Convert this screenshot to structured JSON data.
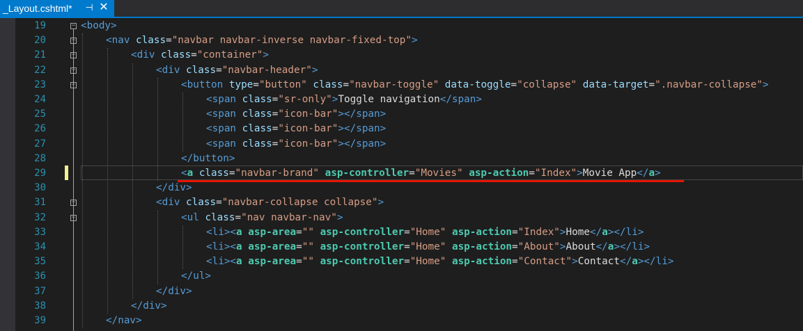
{
  "tab": {
    "title": "_Layout.cshtml*",
    "pin_glyph": "⊣",
    "close_glyph": "✕"
  },
  "colors": {
    "background": "#1e1e1e",
    "line_number": "#2b91af",
    "tag": "#569cd6",
    "attribute": "#9cdcfe",
    "string": "#d69d85",
    "tag_helper": "#4ec9b0",
    "tab_accent": "#007acc",
    "annotation": "#e51400"
  },
  "editor": {
    "lines": [
      {
        "number": "19",
        "tokens": [
          {
            "t": "tag",
            "v": "<body>"
          }
        ]
      },
      {
        "number": "20",
        "tokens": [
          {
            "t": "tag",
            "v": "<nav"
          },
          {
            "t": "txt",
            "v": " "
          },
          {
            "t": "attr",
            "v": "class"
          },
          {
            "t": "txt",
            "v": "="
          },
          {
            "t": "str",
            "v": "\"navbar navbar-inverse navbar-fixed-top\""
          },
          {
            "t": "tag",
            "v": ">"
          }
        ]
      },
      {
        "number": "21",
        "tokens": [
          {
            "t": "tag",
            "v": "<div"
          },
          {
            "t": "txt",
            "v": " "
          },
          {
            "t": "attr",
            "v": "class"
          },
          {
            "t": "txt",
            "v": "="
          },
          {
            "t": "str",
            "v": "\"container\""
          },
          {
            "t": "tag",
            "v": ">"
          }
        ]
      },
      {
        "number": "22",
        "tokens": [
          {
            "t": "tag",
            "v": "<div"
          },
          {
            "t": "txt",
            "v": " "
          },
          {
            "t": "attr",
            "v": "class"
          },
          {
            "t": "txt",
            "v": "="
          },
          {
            "t": "str",
            "v": "\"navbar-header\""
          },
          {
            "t": "tag",
            "v": ">"
          }
        ]
      },
      {
        "number": "23",
        "tokens": [
          {
            "t": "tag",
            "v": "<button"
          },
          {
            "t": "txt",
            "v": " "
          },
          {
            "t": "attr",
            "v": "type"
          },
          {
            "t": "txt",
            "v": "="
          },
          {
            "t": "str",
            "v": "\"button\""
          },
          {
            "t": "txt",
            "v": " "
          },
          {
            "t": "attr",
            "v": "class"
          },
          {
            "t": "txt",
            "v": "="
          },
          {
            "t": "str",
            "v": "\"navbar-toggle\""
          },
          {
            "t": "txt",
            "v": " "
          },
          {
            "t": "attr",
            "v": "data-toggle"
          },
          {
            "t": "txt",
            "v": "="
          },
          {
            "t": "str",
            "v": "\"collapse\""
          },
          {
            "t": "txt",
            "v": " "
          },
          {
            "t": "attr",
            "v": "data-target"
          },
          {
            "t": "txt",
            "v": "="
          },
          {
            "t": "str",
            "v": "\".navbar-collapse\""
          },
          {
            "t": "tag",
            "v": ">"
          }
        ]
      },
      {
        "number": "24",
        "tokens": [
          {
            "t": "tag",
            "v": "<span"
          },
          {
            "t": "txt",
            "v": " "
          },
          {
            "t": "attr",
            "v": "class"
          },
          {
            "t": "txt",
            "v": "="
          },
          {
            "t": "str",
            "v": "\"sr-only\""
          },
          {
            "t": "tag",
            "v": ">"
          },
          {
            "t": "txt",
            "v": "Toggle navigation"
          },
          {
            "t": "tag",
            "v": "</span>"
          }
        ]
      },
      {
        "number": "25",
        "tokens": [
          {
            "t": "tag",
            "v": "<span"
          },
          {
            "t": "txt",
            "v": " "
          },
          {
            "t": "attr",
            "v": "class"
          },
          {
            "t": "txt",
            "v": "="
          },
          {
            "t": "str",
            "v": "\"icon-bar\""
          },
          {
            "t": "tag",
            "v": "></span>"
          }
        ]
      },
      {
        "number": "26",
        "tokens": [
          {
            "t": "tag",
            "v": "<span"
          },
          {
            "t": "txt",
            "v": " "
          },
          {
            "t": "attr",
            "v": "class"
          },
          {
            "t": "txt",
            "v": "="
          },
          {
            "t": "str",
            "v": "\"icon-bar\""
          },
          {
            "t": "tag",
            "v": "></span>"
          }
        ]
      },
      {
        "number": "27",
        "tokens": [
          {
            "t": "tag",
            "v": "<span"
          },
          {
            "t": "txt",
            "v": " "
          },
          {
            "t": "attr",
            "v": "class"
          },
          {
            "t": "txt",
            "v": "="
          },
          {
            "t": "str",
            "v": "\"icon-bar\""
          },
          {
            "t": "tag",
            "v": "></span>"
          }
        ]
      },
      {
        "number": "28",
        "tokens": [
          {
            "t": "tag",
            "v": "</button>"
          }
        ]
      },
      {
        "number": "29",
        "tokens": [
          {
            "t": "tag",
            "v": "<"
          },
          {
            "t": "tagh",
            "v": "a"
          },
          {
            "t": "txt",
            "v": " "
          },
          {
            "t": "attr",
            "v": "class"
          },
          {
            "t": "txt",
            "v": "="
          },
          {
            "t": "str",
            "v": "\"navbar-brand\""
          },
          {
            "t": "txt",
            "v": " "
          },
          {
            "t": "attrh",
            "v": "asp-controller"
          },
          {
            "t": "txt",
            "v": "="
          },
          {
            "t": "str",
            "v": "\"Movies\""
          },
          {
            "t": "txt",
            "v": " "
          },
          {
            "t": "attrh",
            "v": "asp-action"
          },
          {
            "t": "txt",
            "v": "="
          },
          {
            "t": "str",
            "v": "\"Index\""
          },
          {
            "t": "tag",
            "v": ">"
          },
          {
            "t": "txt",
            "v": "Movie App"
          },
          {
            "t": "tag",
            "v": "</"
          },
          {
            "t": "tagh",
            "v": "a"
          },
          {
            "t": "tag",
            "v": ">"
          }
        ]
      },
      {
        "number": "30",
        "tokens": [
          {
            "t": "tag",
            "v": "</div>"
          }
        ]
      },
      {
        "number": "31",
        "tokens": [
          {
            "t": "tag",
            "v": "<div"
          },
          {
            "t": "txt",
            "v": " "
          },
          {
            "t": "attr",
            "v": "class"
          },
          {
            "t": "txt",
            "v": "="
          },
          {
            "t": "str",
            "v": "\"navbar-collapse collapse\""
          },
          {
            "t": "tag",
            "v": ">"
          }
        ]
      },
      {
        "number": "32",
        "tokens": [
          {
            "t": "tag",
            "v": "<ul"
          },
          {
            "t": "txt",
            "v": " "
          },
          {
            "t": "attr",
            "v": "class"
          },
          {
            "t": "txt",
            "v": "="
          },
          {
            "t": "str",
            "v": "\"nav navbar-nav\""
          },
          {
            "t": "tag",
            "v": ">"
          }
        ]
      },
      {
        "number": "33",
        "tokens": [
          {
            "t": "tag",
            "v": "<li><"
          },
          {
            "t": "tagh",
            "v": "a"
          },
          {
            "t": "txt",
            "v": " "
          },
          {
            "t": "attrh",
            "v": "asp-area"
          },
          {
            "t": "txt",
            "v": "="
          },
          {
            "t": "str",
            "v": "\"\""
          },
          {
            "t": "txt",
            "v": " "
          },
          {
            "t": "attrh",
            "v": "asp-controller"
          },
          {
            "t": "txt",
            "v": "="
          },
          {
            "t": "str",
            "v": "\"Home\""
          },
          {
            "t": "txt",
            "v": " "
          },
          {
            "t": "attrh",
            "v": "asp-action"
          },
          {
            "t": "txt",
            "v": "="
          },
          {
            "t": "str",
            "v": "\"Index\""
          },
          {
            "t": "tag",
            "v": ">"
          },
          {
            "t": "txt",
            "v": "Home"
          },
          {
            "t": "tag",
            "v": "</"
          },
          {
            "t": "tagh",
            "v": "a"
          },
          {
            "t": "tag",
            "v": "></li>"
          }
        ]
      },
      {
        "number": "34",
        "tokens": [
          {
            "t": "tag",
            "v": "<li><"
          },
          {
            "t": "tagh",
            "v": "a"
          },
          {
            "t": "txt",
            "v": " "
          },
          {
            "t": "attrh",
            "v": "asp-area"
          },
          {
            "t": "txt",
            "v": "="
          },
          {
            "t": "str",
            "v": "\"\""
          },
          {
            "t": "txt",
            "v": " "
          },
          {
            "t": "attrh",
            "v": "asp-controller"
          },
          {
            "t": "txt",
            "v": "="
          },
          {
            "t": "str",
            "v": "\"Home\""
          },
          {
            "t": "txt",
            "v": " "
          },
          {
            "t": "attrh",
            "v": "asp-action"
          },
          {
            "t": "txt",
            "v": "="
          },
          {
            "t": "str",
            "v": "\"About\""
          },
          {
            "t": "tag",
            "v": ">"
          },
          {
            "t": "txt",
            "v": "About"
          },
          {
            "t": "tag",
            "v": "</"
          },
          {
            "t": "tagh",
            "v": "a"
          },
          {
            "t": "tag",
            "v": "></li>"
          }
        ]
      },
      {
        "number": "35",
        "tokens": [
          {
            "t": "tag",
            "v": "<li><"
          },
          {
            "t": "tagh",
            "v": "a"
          },
          {
            "t": "txt",
            "v": " "
          },
          {
            "t": "attrh",
            "v": "asp-area"
          },
          {
            "t": "txt",
            "v": "="
          },
          {
            "t": "str",
            "v": "\"\""
          },
          {
            "t": "txt",
            "v": " "
          },
          {
            "t": "attrh",
            "v": "asp-controller"
          },
          {
            "t": "txt",
            "v": "="
          },
          {
            "t": "str",
            "v": "\"Home\""
          },
          {
            "t": "txt",
            "v": " "
          },
          {
            "t": "attrh",
            "v": "asp-action"
          },
          {
            "t": "txt",
            "v": "="
          },
          {
            "t": "str",
            "v": "\"Contact\""
          },
          {
            "t": "tag",
            "v": ">"
          },
          {
            "t": "txt",
            "v": "Contact"
          },
          {
            "t": "tag",
            "v": "</"
          },
          {
            "t": "tagh",
            "v": "a"
          },
          {
            "t": "tag",
            "v": "></li>"
          }
        ]
      },
      {
        "number": "36",
        "tokens": [
          {
            "t": "tag",
            "v": "</ul>"
          }
        ]
      },
      {
        "number": "37",
        "tokens": [
          {
            "t": "tag",
            "v": "</div>"
          }
        ]
      },
      {
        "number": "38",
        "tokens": [
          {
            "t": "tag",
            "v": "</div>"
          }
        ]
      },
      {
        "number": "39",
        "tokens": [
          {
            "t": "tag",
            "v": "</nav>"
          }
        ]
      }
    ]
  }
}
